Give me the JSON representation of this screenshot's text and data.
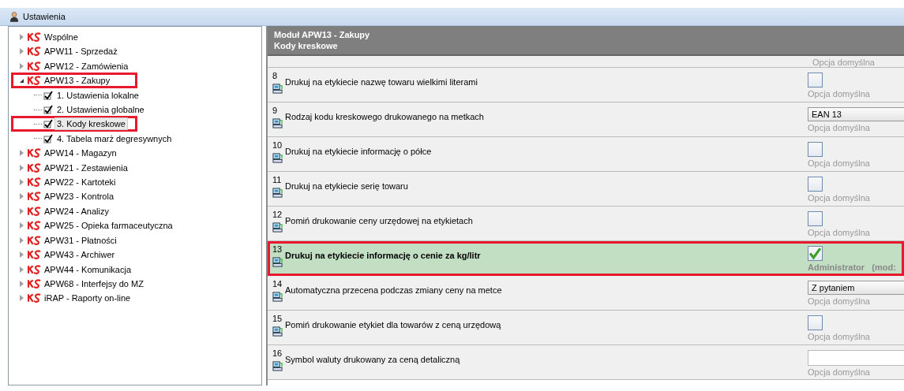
{
  "window": {
    "title": "Ustawienia"
  },
  "tree": [
    {
      "label": "Wspólne",
      "expanded": false,
      "marked": false,
      "selected": false
    },
    {
      "label": "APW11 - Sprzedaż",
      "expanded": false,
      "marked": false,
      "selected": false
    },
    {
      "label": "APW12 - Zamówienia",
      "expanded": false,
      "marked": false,
      "selected": false
    },
    {
      "label": "APW13 - Zakupy",
      "expanded": true,
      "marked": true,
      "selected": false,
      "children": [
        {
          "label": "1. Ustawienia lokalne",
          "marked": false,
          "selected": false
        },
        {
          "label": "2. Ustawienia globalne",
          "marked": false,
          "selected": false
        },
        {
          "label": "3. Kody kreskowe",
          "marked": true,
          "selected": true
        },
        {
          "label": "4. Tabela marż degresywnych",
          "marked": false,
          "selected": false
        }
      ]
    },
    {
      "label": "APW14 - Magazyn",
      "expanded": false,
      "marked": false,
      "selected": false
    },
    {
      "label": "APW21 - Zestawienia",
      "expanded": false,
      "marked": false,
      "selected": false
    },
    {
      "label": "APW22 - Kartoteki",
      "expanded": false,
      "marked": false,
      "selected": false
    },
    {
      "label": "APW23 - Kontrola",
      "expanded": false,
      "marked": false,
      "selected": false
    },
    {
      "label": "APW24 - Analizy",
      "expanded": false,
      "marked": false,
      "selected": false
    },
    {
      "label": "APW25 - Opieka farmaceutyczna",
      "expanded": false,
      "marked": false,
      "selected": false
    },
    {
      "label": "APW31 - Płatności",
      "expanded": false,
      "marked": false,
      "selected": false
    },
    {
      "label": "APW43 - Archiwer",
      "expanded": false,
      "marked": false,
      "selected": false
    },
    {
      "label": "APW44 - Komunikacja",
      "expanded": false,
      "marked": false,
      "selected": false
    },
    {
      "label": "APW68 - Interfejsy do MZ",
      "expanded": false,
      "marked": false,
      "selected": false
    },
    {
      "label": "iRAP - Raporty on-line",
      "expanded": false,
      "marked": false,
      "selected": false
    }
  ],
  "panel": {
    "title": "Moduł APW13 - Zakupy",
    "subtitle": "Kody kreskowe",
    "top_partial_row": {
      "source": "Opcja domyślna"
    },
    "rows": [
      {
        "number": "8",
        "label": "Drukuj na etykiecie nazwę towaru wielkimi literami",
        "kind": "checkbox",
        "checked": false,
        "source": "Opcja domyślna",
        "selected": false,
        "marked": false
      },
      {
        "number": "9",
        "label": "Rodzaj kodu kreskowego drukowanego na metkach",
        "kind": "dropdown",
        "value": "EAN 13",
        "source": "Opcja domyślna",
        "selected": false,
        "marked": false
      },
      {
        "number": "10",
        "label": "Drukuj na etykiecie informację o półce",
        "kind": "checkbox",
        "checked": false,
        "source": "Opcja domyślna",
        "selected": false,
        "marked": false
      },
      {
        "number": "11",
        "label": "Drukuj na etykiecie serię towaru",
        "kind": "checkbox",
        "checked": false,
        "source": "Opcja domyślna",
        "selected": false,
        "marked": false
      },
      {
        "number": "12",
        "label": "Pomiń drukowanie ceny urzędowej na etykietach",
        "kind": "checkbox",
        "checked": false,
        "source": "Opcja domyślna",
        "selected": false,
        "marked": false
      },
      {
        "number": "13",
        "label": "Drukuj na etykiecie informację o cenie za kg/litr",
        "kind": "checkbox",
        "checked": true,
        "source": "Administrator   (mod:",
        "selected": true,
        "marked": true
      },
      {
        "number": "14",
        "label": "Automatyczna przecena podczas zmiany ceny na metce",
        "kind": "dropdown",
        "value": "Z pytaniem",
        "source": "Opcja domyślna",
        "selected": false,
        "marked": false
      },
      {
        "number": "15",
        "label": "Pomiń drukowanie etykiet dla towarów z ceną urzędową",
        "kind": "checkbox",
        "checked": false,
        "source": "Opcja domyślna",
        "selected": false,
        "marked": false
      },
      {
        "number": "16",
        "label": "Symbol waluty drukowany za ceną detaliczną",
        "kind": "text",
        "value": "",
        "source": "Opcja domyślna",
        "selected": false,
        "marked": false
      }
    ]
  }
}
